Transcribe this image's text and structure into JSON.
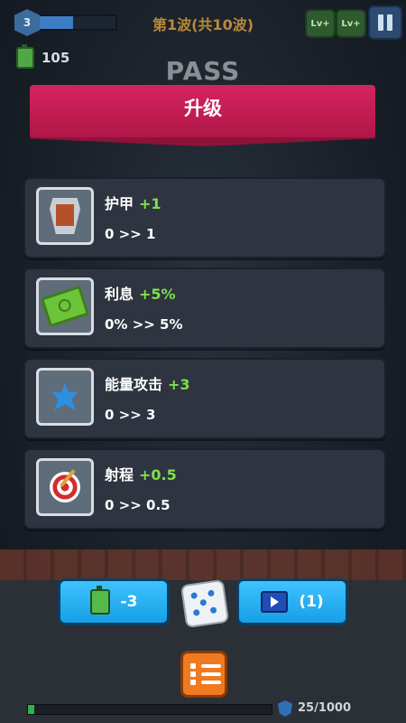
{
  "hud": {
    "level": "3",
    "xp_fraction": 0.45,
    "wave_title": "第1波(共10波)",
    "lvplus_1": "Lv+",
    "lvplus_2": "Lv+",
    "battery_count": "105",
    "status_text": "PASS"
  },
  "upgrade_panel": {
    "title": "升级",
    "options": [
      {
        "name": "护甲",
        "bonus": "+1",
        "change": "0 >> 1",
        "icon": "armor-shield-icon"
      },
      {
        "name": "利息",
        "bonus": "+5%",
        "change": "0% >> 5%",
        "icon": "cash-stack-icon"
      },
      {
        "name": "能量攻击",
        "bonus": "+3",
        "change": "0 >> 3",
        "icon": "energy-burst-icon"
      },
      {
        "name": "射程",
        "bonus": "+0.5",
        "change": "0 >> 0.5",
        "icon": "target-arrow-icon"
      }
    ]
  },
  "controls": {
    "reroll_cost": "-3",
    "ad_reroll_count": "(1)",
    "progress_fraction": 0.025,
    "progress_text": "25/1000"
  },
  "colors": {
    "banner": "#d6235f",
    "bonus_green": "#7ee04a",
    "button_blue": "#16a0e6",
    "menu_orange": "#f07a1f"
  }
}
